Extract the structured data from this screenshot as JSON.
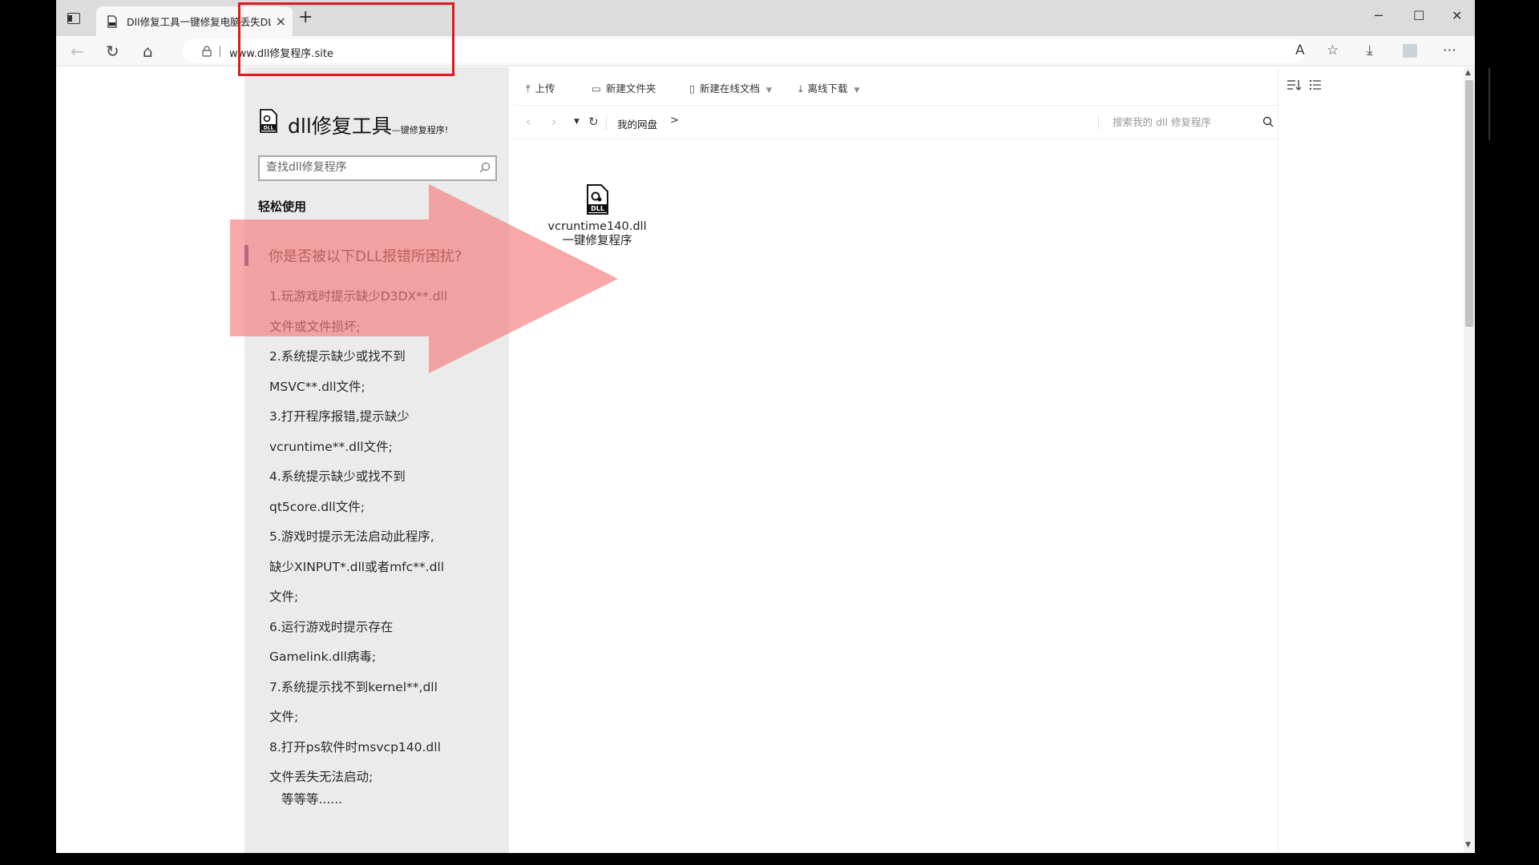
{
  "browser": {
    "tab": {
      "title": "Dll修复工具一键修复电脑丢失DLL",
      "close_glyph": "×"
    },
    "new_tab_glyph": "+",
    "window": {
      "minimize": "─",
      "maximize": "☐",
      "close": "✕"
    },
    "nav": {
      "back": "←",
      "refresh": "↻",
      "home": "⌂"
    },
    "url": "www.dll修复程序.site",
    "toolbar_icons": {
      "read_aloud": "A",
      "favorites": "☆",
      "downloads": "⤓",
      "menu": "⋯"
    }
  },
  "left_panel": {
    "site_title": "dll修复工具",
    "site_subtitle": "—键修复程序!",
    "search_placeholder": "查找dll修复程序",
    "section_title": "轻松使用",
    "question": "你是否被以下DLL报错所困扰?",
    "issues": [
      "1.玩游戏时提示缺少D3DX**.dll",
      "文件或文件损坏;",
      "2.系统提示缺少或找不到",
      "MSVC**.dll文件;",
      "3.打开程序报错,提示缺少",
      "vcruntime**.dll文件;",
      "4.系统提示缺少或找不到",
      "qt5core.dll文件;",
      "5.游戏时提示无法启动此程序,",
      "缺少XINPUT*.dll或者mfc**.dll",
      "文件;",
      "6.运行游戏时提示存在",
      "Gamelink.dll病毒;",
      "7.系统提示找不到kernel**,dll",
      "文件;",
      "8.打开ps软件时msvcp140.dll",
      "文件丢失无法启动;"
    ],
    "etc": "等等等......"
  },
  "file_manager": {
    "toolbar": {
      "upload": "上传",
      "new_folder": "新建文件夹",
      "new_online_doc": "新建在线文档",
      "offline_download": "离线下载"
    },
    "breadcrumb_root": "我的网盘",
    "breadcrumb_sep": ">",
    "search_placeholder": "搜索我的 dll 修复程序",
    "files": [
      {
        "name_line1": "vcruntime140.dll",
        "name_line2": "一键修复程序"
      }
    ]
  },
  "colors": {
    "highlight_box": "#e3161b",
    "arrow_overlay": "#f47a7a",
    "left_panel_bg": "#ebebeb",
    "question_accent": "#4a3d8c"
  }
}
